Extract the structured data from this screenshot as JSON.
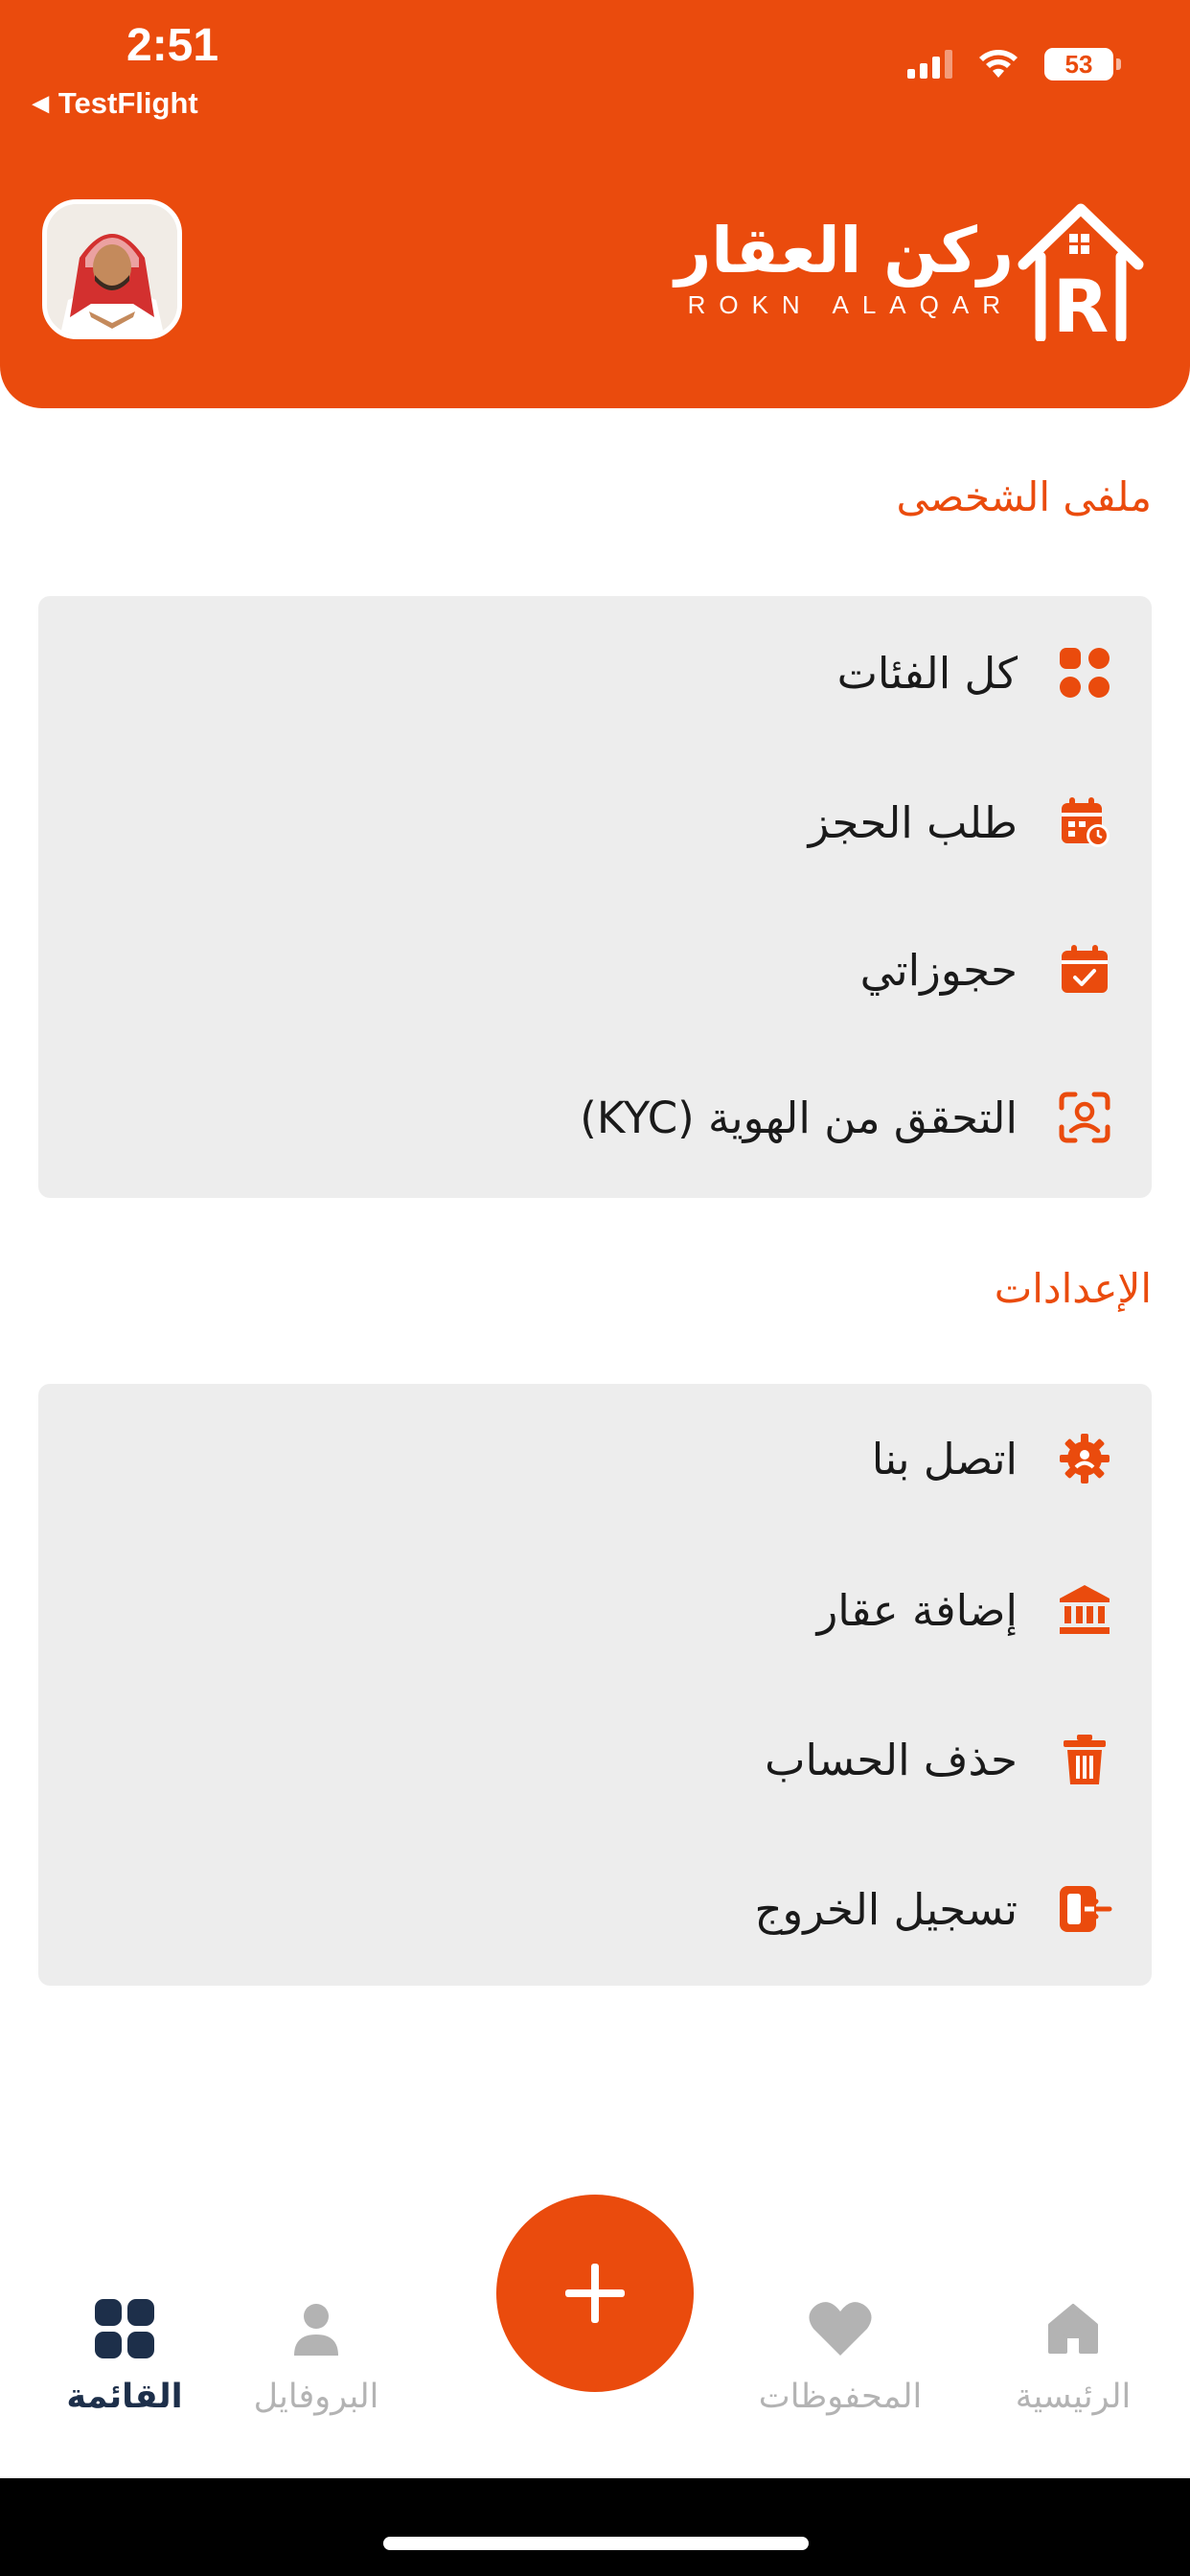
{
  "status_bar": {
    "time": "2:51",
    "back_app": "TestFlight",
    "battery": "53"
  },
  "header": {
    "logo_ar": "ركن العقار",
    "logo_en": "ROKN ALAQAR",
    "brand_color": "#EA4B0D"
  },
  "profile_section": {
    "title": "ملفى الشخصى",
    "items": [
      {
        "label": "كل الفئات",
        "icon": "grid-icon"
      },
      {
        "label": "طلب الحجز",
        "icon": "calendar-clock-icon"
      },
      {
        "label": "حجوزاتي",
        "icon": "calendar-check-icon"
      },
      {
        "label": "التحقق من الهوية (KYC)",
        "icon": "face-id-icon"
      }
    ]
  },
  "settings_section": {
    "title": "الإعدادات",
    "items": [
      {
        "label": "اتصل بنا",
        "icon": "support-gear-icon"
      },
      {
        "label": "إضافة عقار",
        "icon": "bank-icon"
      },
      {
        "label": "حذف الحساب",
        "icon": "trash-icon"
      },
      {
        "label": "تسجيل الخروج",
        "icon": "logout-icon"
      }
    ]
  },
  "bottom_nav": {
    "items": [
      {
        "label": "القائمة",
        "icon": "grid-icon",
        "active": true
      },
      {
        "label": "البروفايل",
        "icon": "person-icon",
        "active": false
      },
      {
        "label": "المحفوظات",
        "icon": "heart-icon",
        "active": false
      },
      {
        "label": "الرئيسية",
        "icon": "home-icon",
        "active": false
      }
    ],
    "fab_icon": "plus-icon"
  }
}
